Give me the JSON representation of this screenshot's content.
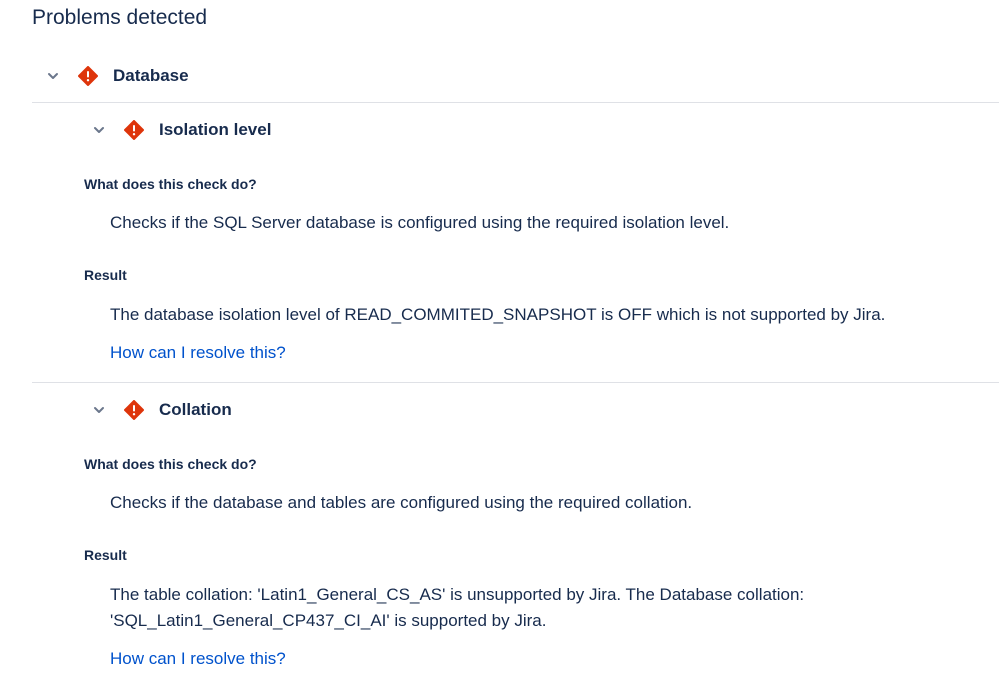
{
  "page": {
    "title": "Problems detected"
  },
  "group": {
    "title": "Database",
    "status_color": "#de350b",
    "checks": [
      {
        "title": "Isolation level",
        "what_label": "What does this check do?",
        "what_text": "Checks if the SQL Server database is configured using the required isolation level.",
        "result_label": "Result",
        "result_text": "The database isolation level of READ_COMMITED_SNAPSHOT is OFF which is not supported by Jira.",
        "link_text": "How can I resolve this?"
      },
      {
        "title": "Collation",
        "what_label": "What does this check do?",
        "what_text": "Checks if the database and tables are configured using the required collation.",
        "result_label": "Result",
        "result_text": "The table collation: 'Latin1_General_CS_AS' is unsupported by Jira. The Database collation: 'SQL_Latin1_General_CP437_CI_AI' is supported by Jira.",
        "link_text": "How can I resolve this?"
      }
    ]
  },
  "icons": {
    "expand": "chevron-down-icon",
    "error": "error-diamond-icon"
  }
}
